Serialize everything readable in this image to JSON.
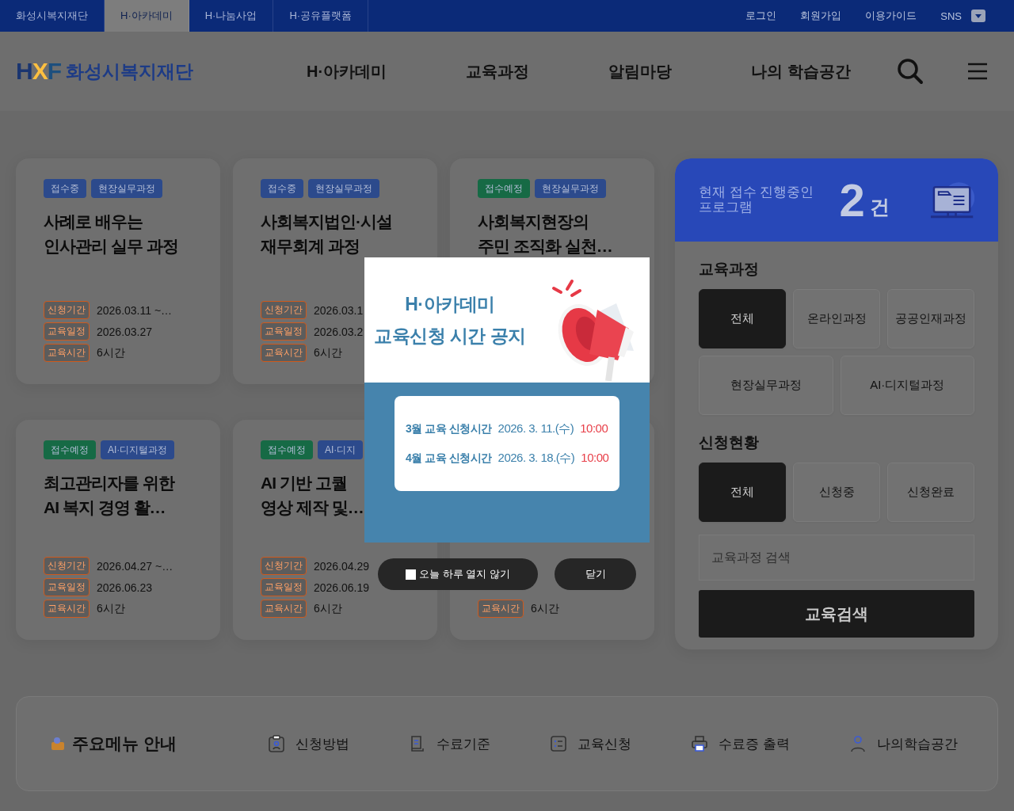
{
  "top_bar": {
    "tabs": [
      {
        "label": "화성시복지재단",
        "selected": false
      },
      {
        "label": "H·아카데미",
        "selected": true
      },
      {
        "label": "H·나눔사업",
        "selected": false
      },
      {
        "label": "H·공유플랫폼",
        "selected": false
      }
    ],
    "links": [
      "로그인",
      "회원가입",
      "이용가이드",
      "SNS"
    ]
  },
  "header": {
    "logo_mark": "HXF",
    "logo_text": "화성시복지재단",
    "nav": [
      "H·아카데미",
      "교육과정",
      "알림마당",
      "나의 학습공간"
    ]
  },
  "courses": [
    {
      "status": {
        "label": "접수중",
        "color": "#2c4a8c"
      },
      "category": "현장실무과정",
      "title": "사례로 배우는\n인사관리 실무 과정",
      "info": [
        {
          "label": "신청기간",
          "value": "2026.03.11 ~…"
        },
        {
          "label": "교육일정",
          "value": "2026.03.27"
        },
        {
          "label": "교육시간",
          "value": "6시간"
        }
      ]
    },
    {
      "status": {
        "label": "접수중",
        "color": "#2c4a8c"
      },
      "category": "현장실무과정",
      "title": "사회복지법인·시설\n재무회계 과정",
      "info": [
        {
          "label": "신청기간",
          "value": "2026.03.1"
        },
        {
          "label": "교육일정",
          "value": "2026.03.2"
        },
        {
          "label": "교육시간",
          "value": "6시간"
        }
      ]
    },
    {
      "status": {
        "label": "접수예정",
        "color": "#166a45"
      },
      "category": "현장실무과정",
      "title": "사회복지현장의\n주민 조직화 실천…"
    },
    {
      "status": {
        "label": "접수예정",
        "color": "#166a45"
      },
      "category": "AI·디지털과정",
      "title": "최고관리자를 위한\nAI 복지 경영 활…",
      "info": [
        {
          "label": "신청기간",
          "value": "2026.04.27 ~…"
        },
        {
          "label": "교육일정",
          "value": "2026.06.23"
        },
        {
          "label": "교육시간",
          "value": "6시간"
        }
      ]
    },
    {
      "status": {
        "label": "접수예정",
        "color": "#166a45"
      },
      "category": "AI·디지",
      "title": "AI 기반 고퀄\n영상 제작 및…",
      "info": [
        {
          "label": "신청기간",
          "value": "2026.04.29"
        },
        {
          "label": "교육일정",
          "value": "2026.06.19"
        },
        {
          "label": "교육시간",
          "value": "6시간"
        }
      ]
    },
    {
      "info": [
        {
          "label": "교육시간",
          "value": "6시간"
        }
      ]
    }
  ],
  "sidebar": {
    "banner": {
      "label": "현재 접수 진행중인\n프로그램",
      "count": "2",
      "unit": "건"
    },
    "filters": [
      {
        "title": "교육과정",
        "options": [
          {
            "label": "전체",
            "selected": true
          },
          {
            "label": "온라인과정",
            "selected": false
          },
          {
            "label": "공공인재과정",
            "selected": false
          },
          {
            "label": "현장실무과정",
            "selected": false
          },
          {
            "label": "AI·디지털과정",
            "selected": false
          }
        ]
      },
      {
        "title": "신청현황",
        "options": [
          {
            "label": "전체",
            "selected": true
          },
          {
            "label": "신청중",
            "selected": false
          },
          {
            "label": "신청완료",
            "selected": false
          }
        ]
      }
    ],
    "search": {
      "placeholder": "교육과정 검색"
    },
    "search_button": "교육검색"
  },
  "menu_guide": {
    "title": "주요메뉴 안내",
    "items": [
      "신청방법",
      "수료기준",
      "교육신청",
      "수료증 출력",
      "나의학습공간"
    ]
  },
  "popup": {
    "title": "H·아카데미\n교육신청 시간 공지",
    "rows": [
      {
        "label": "3월 교육 신청시간",
        "date": "2026. 3. 11.(수)",
        "time": "10:00"
      },
      {
        "label": "4월 교육 신청시간",
        "date": "2026. 3. 18.(수)",
        "time": "10:00"
      }
    ],
    "dont_show": {
      "label": "오늘 하루 열지 않기",
      "checked": false
    },
    "close": "닫기"
  }
}
